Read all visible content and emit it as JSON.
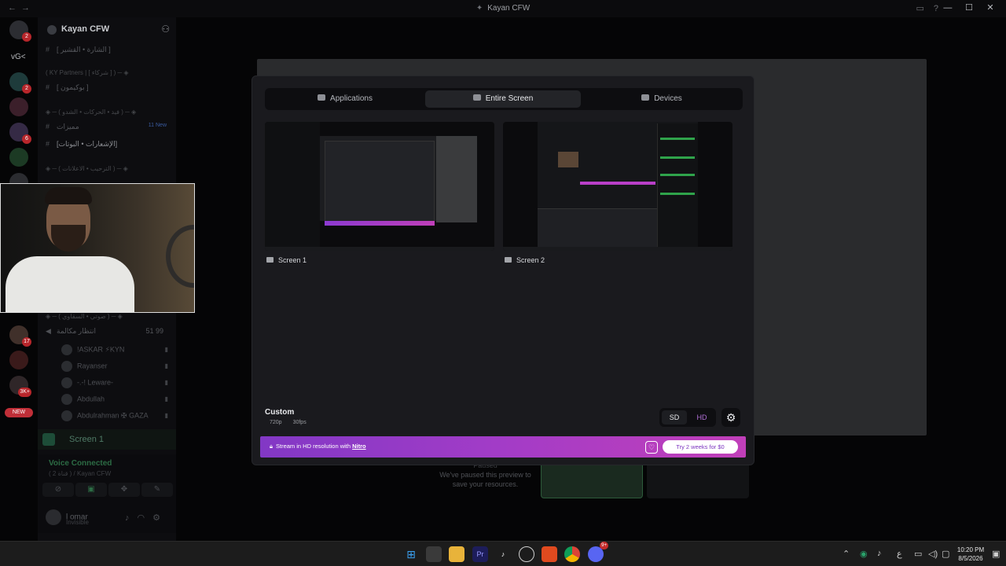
{
  "window": {
    "title": "Kayan CFW",
    "controls": [
      "—",
      "☐",
      "✕"
    ]
  },
  "rail": {
    "label": "vG<",
    "new_badge": "NEW",
    "badges": [
      "2",
      "2",
      "6",
      "6",
      "17",
      "140",
      "3K+"
    ]
  },
  "server": {
    "name": "Kayan CFW",
    "channels": [
      {
        "name": "[ الشارة • القشير ]"
      },
      {
        "name": "[ بوكيمون ]"
      },
      {
        "name": "مميزات",
        "tag": "11 New"
      },
      {
        "name": "[الإشعارات • البوتات]"
      },
      {
        "name": "[ نقاشات ]"
      }
    ],
    "categories": [
      "( KY Partners | [ شركاء ] ) ─ ◈",
      "◈ ─ ( فيد • الحركات • الشدو ) ─ ◈",
      "◈ ─ ( الترحيب • الاعلانات ) ─ ◈",
      "◈ ─ ( صوتي • السقاوي ) ─ ◈"
    ],
    "voice_channel": {
      "name": "انتظار مكالمة",
      "count": "51",
      "limit": "99"
    },
    "members": [
      {
        "name": "!ASKAR ⚡KYN"
      },
      {
        "name": "Rayanser"
      },
      {
        "name": "-.-! Leware-"
      },
      {
        "name": "Abdullah"
      },
      {
        "name": "Abdulrahman ✠ GAZA"
      }
    ]
  },
  "screenshare_bar": {
    "label": "Screen 1"
  },
  "voice_panel": {
    "status": "Voice Connected",
    "sub": "( قناة 2 ) / Kayan CFW",
    "user": "l omar",
    "user_status": "Invisible"
  },
  "preview": {
    "paused_title": "Paused",
    "paused_text": "We've paused this preview to save your resources."
  },
  "modal": {
    "tabs": [
      {
        "label": "Applications",
        "icon": "app-window-icon",
        "active": false
      },
      {
        "label": "Entire Screen",
        "icon": "monitor-icon",
        "active": true
      },
      {
        "label": "Devices",
        "icon": "camera-icon",
        "active": false
      }
    ],
    "screens": [
      {
        "label": "Screen 1"
      },
      {
        "label": "Screen 2"
      }
    ],
    "quality": {
      "title": "Custom",
      "resolution": "720p",
      "fps": "30fps",
      "sd": "SD",
      "hd": "HD",
      "selected": "SD"
    },
    "nitro": {
      "text": "Stream in HD resolution with",
      "link": "Nitro",
      "cta": "Try 2 weeks for $0"
    }
  },
  "taskbar": {
    "apps": [
      "windows-start-icon",
      "file-explorer-icon",
      "folder-icon",
      "premiere-icon",
      "tiktok-icon",
      "obs-icon",
      "brave-icon",
      "chrome-icon",
      "discord-icon"
    ],
    "premiere_label": "Pr",
    "discord_badge": "9+",
    "language": "ع",
    "time": "10:20 PM",
    "date": "8/5/2026"
  },
  "colors": {
    "accent_purple": "#a33cc7",
    "voice_green": "#2c6b44",
    "modal_bg": "#1a1a1e"
  }
}
